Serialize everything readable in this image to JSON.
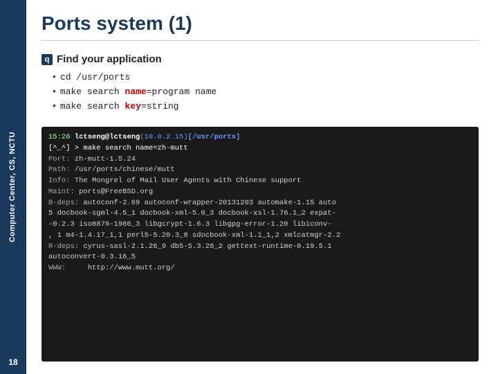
{
  "sidebar": {
    "label": "Computer Center, CS, NCTU",
    "page_number": "18"
  },
  "header": {
    "title": "Ports system (1)"
  },
  "section": {
    "heading": "Find your application",
    "bullets": [
      {
        "text": "cd /usr/ports",
        "highlight": false
      },
      {
        "text": "make search name=program name",
        "highlight": true,
        "keyword": "name",
        "cmd_base": "make search ",
        "cmd_key": "name",
        "cmd_eq": "=",
        "cmd_val": "program name"
      },
      {
        "text": "make search key=string",
        "highlight": true,
        "keyword": "key",
        "cmd_base": "make search ",
        "cmd_key": "key",
        "cmd_eq": "=",
        "cmd_val": "string"
      }
    ]
  },
  "terminal": {
    "lines": [
      {
        "type": "prompt",
        "time": "15:26",
        "user": "lctseng@lctseng",
        "ip": "(10.0.2.15)",
        "path": "[/usr/ports]"
      },
      {
        "type": "cmd_line",
        "content": "> make search name=zh-mutt"
      },
      {
        "type": "data",
        "label": "Port:",
        "value": "zh-mutt-1.5.24"
      },
      {
        "type": "data",
        "label": "Path:",
        "value": "/usr/ports/chinese/mutt"
      },
      {
        "type": "data",
        "label": "Info:",
        "value": "The Mongrel of Mail User Agents with Chinese support"
      },
      {
        "type": "data",
        "label": "Maint:",
        "value": "ports@FreeBSD.org"
      },
      {
        "type": "data_long",
        "label": "B-deps:",
        "value": "autoconf-2.69 autoconf-wrapper-20131203 automake-1.15 auto"
      },
      {
        "type": "data_cont",
        "value": "5 docbook-sgml-4.5_1 docbook-xml-5.0_3 docbook-xsl-1.76.1_2 expat-"
      },
      {
        "type": "data_cont",
        "value": "-0.2.3 iso8879-1986_3 libgcrypt-1.6.3 libgpg-error-1.20 libiconv-"
      },
      {
        "type": "data_cont",
        "value": ", 1 m4-1.4.17_1,1 perl5-5.20.3_8 sdocbook-xml-1.1_1,2 xmlcatmgr-2.2"
      },
      {
        "type": "data",
        "label": "R-deps:",
        "value": "cyrus-sasl-2.1.26_9 db5-5.3.28_2 gettext-runtime-0.19.5.1"
      },
      {
        "type": "data_cont",
        "value": "autoconvert-0.3.16_5"
      },
      {
        "type": "data",
        "label": "WWW:",
        "value": "    http://www.mutt.org/"
      }
    ]
  }
}
